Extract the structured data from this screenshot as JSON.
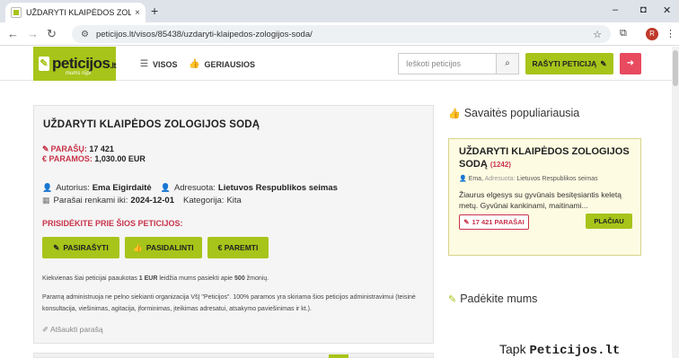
{
  "browser": {
    "tab_title": "UŽDARYTI KLAIPĖDOS ZOLOGIJOS SODĄ",
    "tab_close": "×",
    "new_tab": "+",
    "url": "peticijos.lt/visos/85438/uzdaryti-klaipedos-zologijos-soda/",
    "profile_initial": "R",
    "win_min": "–",
    "win_max": "◘",
    "win_close": "✕"
  },
  "header": {
    "logo_text": "peticijos",
    "logo_tld": ".lt",
    "logo_sub": "mums rūpi",
    "menu": [
      {
        "label": "VISOS"
      },
      {
        "label": "GERIAUSIOS"
      }
    ],
    "search_placeholder": "Ieškoti peticijos",
    "write_button": "RAŠYTI PETICIJĄ"
  },
  "petition": {
    "title": "UŽDARYTI KLAIPĖDOS ZOLOGIJOS SODĄ",
    "signatures_label": "PARAŠŲ:",
    "signatures_value": "17 421",
    "support_label": "€ PARAMOS:",
    "support_value": "1,030.00 EUR",
    "author_label": "Autorius:",
    "author_value": "Ema Eigirdaitė",
    "addressee_label": "Adresuota:",
    "addressee_value": "Lietuvos Respublikos seimas",
    "deadline_label": "Parašai renkami iki:",
    "deadline_value": "2024-12-01",
    "category_label": "Kategorija:",
    "category_value": "Kita",
    "join_heading": "PRISIDĖKITE PRIE ŠIOS PETICIJOS:",
    "buttons": {
      "sign": "PASIRAŠYTI",
      "share": "PASIDALINTI",
      "support": "€  PAREMTI"
    },
    "note1_a": "Kiekvienas šiai peticijai paaukotas",
    "note1_b": "1 EUR",
    "note1_c": "leidžia mums pasiekti apie",
    "note1_d": "500",
    "note1_e": "žmonių.",
    "note2": "Paramą administruoja ne pelno siekianti organizacija VšĮ \"Peticijos\". 100% paramos yra skiriama šios peticijos administravimui (teisinė konsultacija, viešinimas, agitacija, įforminimas, įteikimas adresatui, atsakymo paviešinimas ir kt.).",
    "revoke": "Atšaukti parašą"
  },
  "sidebar": {
    "weekly_heading": "Savaitės populiariausia",
    "popular": {
      "title": "UŽDARYTI KLAIPĖDOS ZOLOGIJOS SODĄ",
      "count": "(1242)",
      "author": "Ema,",
      "addressed": "Adresuota:",
      "addressee": "Lietuvos Respublikos seimas",
      "description": "Žiaurus elgesys su gyvūnais besitęsiantis keletą metų. Gyvūnai kankinami, maitinami...",
      "signatures": "17 421 PARAŠAI",
      "more": "PLAČIAU"
    },
    "help_heading": "Padėkite mums",
    "tapk_a": "Tapk",
    "tapk_b": "Peticijos.lt"
  },
  "colors": {
    "accent": "#a7c41a",
    "danger": "#c8334a",
    "login": "#e84a5f"
  }
}
